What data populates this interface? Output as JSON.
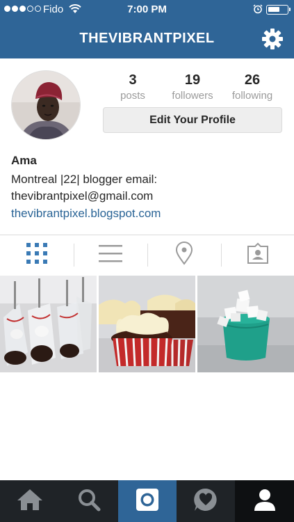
{
  "status_bar": {
    "carrier": "Fido",
    "time": "7:00 PM",
    "signal_dots_filled": 3,
    "signal_dots_total": 5,
    "battery_level": 0.5
  },
  "header": {
    "username": "THEVIBRANTPIXEL",
    "settings_icon": "gear-icon"
  },
  "profile": {
    "stats": [
      {
        "value": "3",
        "label": "posts"
      },
      {
        "value": "19",
        "label": "followers"
      },
      {
        "value": "26",
        "label": "following"
      }
    ],
    "edit_button_label": "Edit Your Profile",
    "name": "Ama",
    "bio_line1": "Montreal |22| blogger email:",
    "bio_line2": "thevibrantpixel@gmail.com",
    "website": "thevibrantpixel.blogspot.com"
  },
  "view_tabs": [
    {
      "icon": "grid-icon",
      "selected": true
    },
    {
      "icon": "list-icon",
      "selected": false
    },
    {
      "icon": "location-pin-icon",
      "selected": false
    },
    {
      "icon": "tagged-photos-icon",
      "selected": false
    }
  ],
  "photos": [
    {
      "subject": "hot-chocolate-spoons-photo"
    },
    {
      "subject": "cupcakes-photo"
    },
    {
      "subject": "marshmallows-photo"
    }
  ],
  "bottom_nav": [
    {
      "icon": "home-icon"
    },
    {
      "icon": "search-icon"
    },
    {
      "icon": "camera-icon"
    },
    {
      "icon": "activity-heart-icon"
    },
    {
      "icon": "profile-icon"
    }
  ],
  "colors": {
    "header_blue": "#2f6597",
    "link_blue": "#2a6496",
    "tab_blue": "#3a7ab5",
    "nav_dark": "#1f2327"
  }
}
